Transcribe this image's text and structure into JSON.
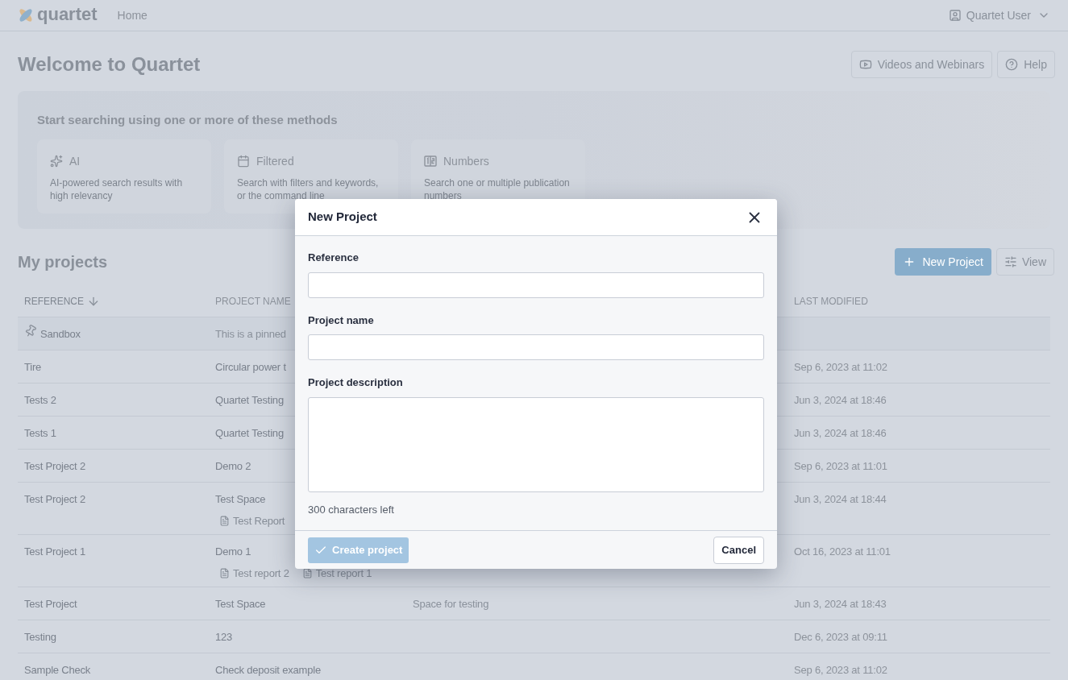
{
  "header": {
    "logo_text": "quartet",
    "nav": [
      {
        "label": "Home"
      }
    ],
    "user": {
      "name": "Quartet User"
    }
  },
  "page": {
    "title": "Welcome to Quartet",
    "buttons": [
      {
        "kind": "video",
        "label": "Videos and Webinars"
      },
      {
        "kind": "help",
        "label": "Help"
      }
    ]
  },
  "search_methods": {
    "title": "Start searching using one or more of these methods",
    "methods": [
      {
        "kind": "ai",
        "title": "AI",
        "description": "AI-powered search results with high relevancy"
      },
      {
        "kind": "filtered",
        "title": "Filtered",
        "description": "Search with filters and keywords, or the command line"
      },
      {
        "kind": "numbers",
        "title": "Numbers",
        "description": "Search one or multiple publication numbers"
      }
    ]
  },
  "projects": {
    "title": "My projects",
    "new_button": "New Project",
    "view_button": "View",
    "table": {
      "columns": [
        {
          "label": "REFERENCE",
          "sorted": true
        },
        {
          "label": "PROJECT NAME",
          "sorted": false
        },
        {
          "label": "LAST MODIFIED",
          "sorted": false
        }
      ],
      "rows": [
        {
          "reference": "Sandbox",
          "pinned": true,
          "note": "This is a pinned"
        },
        {
          "reference": "Tire",
          "pinned": false,
          "project_name": "Circular power t",
          "last_modified": "Sep 6, 2023 at 11:02"
        },
        {
          "reference": "Tests 2",
          "pinned": false,
          "project_name": "Quartet Testing",
          "last_modified": "Jun 3, 2024 at 18:46"
        },
        {
          "reference": "Tests 1",
          "pinned": false,
          "project_name": "Quartet Testing",
          "last_modified": "Jun 3, 2024 at 18:46"
        },
        {
          "reference": "Test Project 2",
          "pinned": false,
          "project_name": "Demo 2",
          "last_modified": "Sep 6, 2023 at 11:01"
        },
        {
          "reference": "Test Project 2",
          "pinned": false,
          "project_name": "Test Space",
          "reports": [
            "Test Report"
          ],
          "last_modified": "Jun 3, 2024 at 18:44"
        },
        {
          "reference": "Test Project 1",
          "pinned": false,
          "project_name": "Demo 1",
          "reports": [
            "Test report 2",
            "Test report 1"
          ],
          "last_modified": "Oct 16, 2023 at 11:01"
        },
        {
          "reference": "Test Project",
          "pinned": false,
          "project_name": "Test Space",
          "description": "Space for testing",
          "last_modified": "Jun 3, 2024 at 18:43"
        },
        {
          "reference": "Testing",
          "pinned": false,
          "project_name": "123",
          "last_modified": "Dec 6, 2023 at 09:11"
        },
        {
          "reference": "Sample Check",
          "pinned": false,
          "project_name": "Check deposit example",
          "last_modified": "Sep 6, 2023 at 11:02"
        }
      ]
    }
  },
  "modal": {
    "title": "New Project",
    "fields": [
      {
        "kind": "input",
        "label": "Reference"
      },
      {
        "kind": "input",
        "label": "Project name"
      },
      {
        "kind": "textarea",
        "label": "Project description"
      }
    ],
    "counter": "300 characters left",
    "create_button": {
      "label": "Create project",
      "disabled": true
    },
    "cancel_button": "Cancel"
  }
}
